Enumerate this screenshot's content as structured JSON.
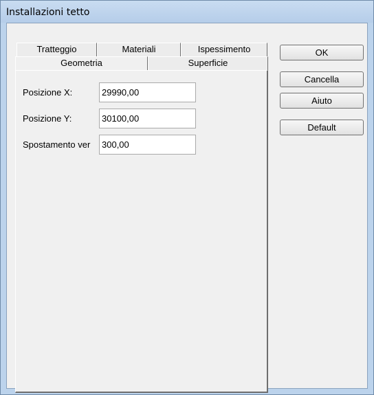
{
  "window": {
    "title": "Installazioni tetto"
  },
  "tabs": {
    "row1": [
      "Tratteggio",
      "Materiali",
      "Ispessimento"
    ],
    "row2": [
      "Geometria",
      "Superficie"
    ],
    "active": "Geometria"
  },
  "fields": [
    {
      "label": "Posizione X:",
      "value": "29990,00"
    },
    {
      "label": "Posizione Y:",
      "value": "30100,00"
    },
    {
      "label": "Spostamento ver",
      "value": "300,00"
    }
  ],
  "buttons": {
    "ok": "OK",
    "cancel": "Cancella",
    "help": "Aiuto",
    "default": "Default"
  }
}
